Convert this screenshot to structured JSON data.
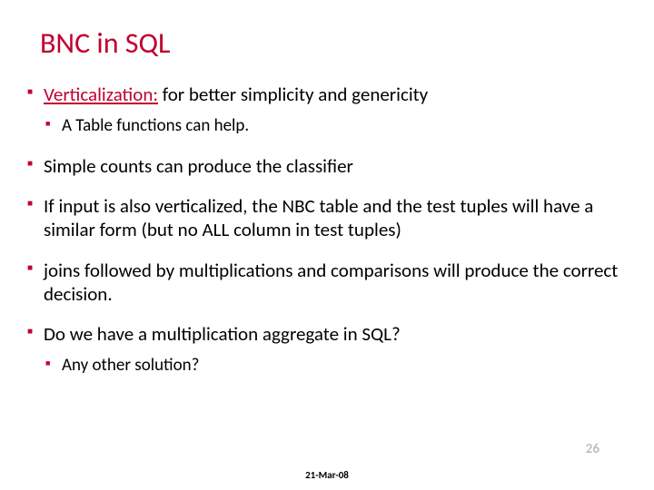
{
  "title": "BNC in SQL",
  "bullets": {
    "b1_vert": "Verticalization:",
    "b1_rest": " for better simplicity and genericity",
    "b1_sub": "A Table functions can help.",
    "b2": "Simple counts can produce the classifier",
    "b3": " If input is also verticalized, the NBC table  and the test tuples will have a similar form (but no  ALL column in test tuples)",
    "b4": " joins  followed by multiplications and comparisons  will produce the correct decision.",
    "b5": "Do we have a multiplication aggregate in SQL?",
    "b5_sub": "Any other solution?"
  },
  "page_number": "26",
  "footer_date": "21-Mar-08"
}
